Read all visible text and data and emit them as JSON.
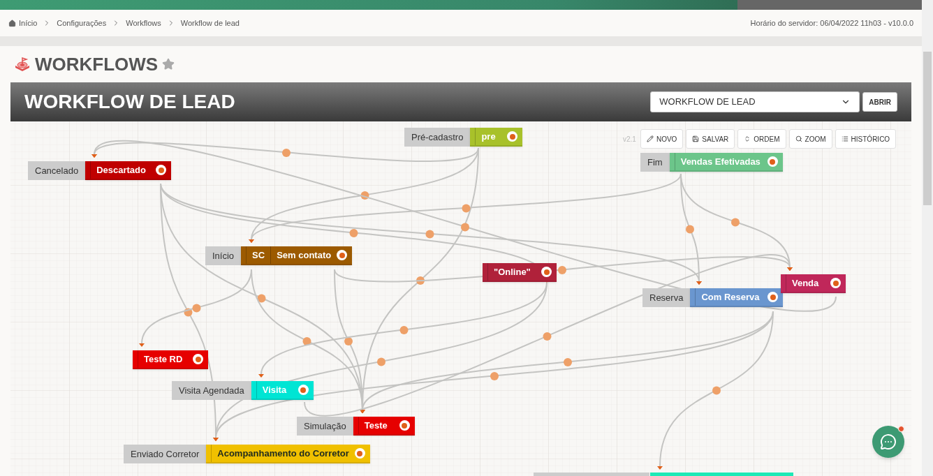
{
  "breadcrumb": [
    {
      "label": "Início",
      "kind": "home"
    },
    {
      "label": "Configurações",
      "kind": "link"
    },
    {
      "label": "Workflows",
      "kind": "link"
    },
    {
      "label": "Workflow de lead",
      "kind": "link"
    }
  ],
  "server_time": "Horário do servidor: 06/04/2022 11h03 - v10.0.0",
  "page_title": "WORKFLOWS",
  "workflow": {
    "title": "WORKFLOW DE LEAD",
    "select_value": "WORKFLOW DE LEAD",
    "open_button": "ABRIR"
  },
  "toolbar": {
    "version": "v2.1",
    "buttons": [
      {
        "label": "NOVO",
        "kind": "new"
      },
      {
        "label": "SALVAR",
        "kind": "save"
      },
      {
        "label": "ORDEM",
        "kind": "order"
      },
      {
        "label": "ZOOM",
        "kind": "zoom"
      },
      {
        "label": "HISTÓRICO",
        "kind": "history"
      }
    ]
  },
  "nodes": [
    {
      "tag": "Pré-cadastro",
      "name": "pre",
      "color": "#a8c12a"
    },
    {
      "tag": "Cancelado",
      "name": "Descartado",
      "color": "#c00000"
    },
    {
      "tag": "Fim",
      "name": "Vendas Efetivadas",
      "color": "#6cc58a"
    },
    {
      "tag": "Início",
      "code": "SC",
      "name": "Sem contato",
      "color": "#9c5a00"
    },
    {
      "name": "\"Online\"",
      "color": "#b0213a"
    },
    {
      "tag": "Reserva",
      "name": "Com Reserva",
      "color": "#6a96cf"
    },
    {
      "name": "Venda",
      "color": "#c0275a"
    },
    {
      "name": "Teste RD",
      "color": "#e60000"
    },
    {
      "tag": "Visita Agendada",
      "name": "Visita",
      "color": "#00e5d4"
    },
    {
      "tag": "Simulação",
      "name": "Teste",
      "color": "#e60000"
    },
    {
      "tag": "Enviado Corretor",
      "name": "Acompanhamento do Corretor",
      "color": "#f0c000"
    }
  ]
}
